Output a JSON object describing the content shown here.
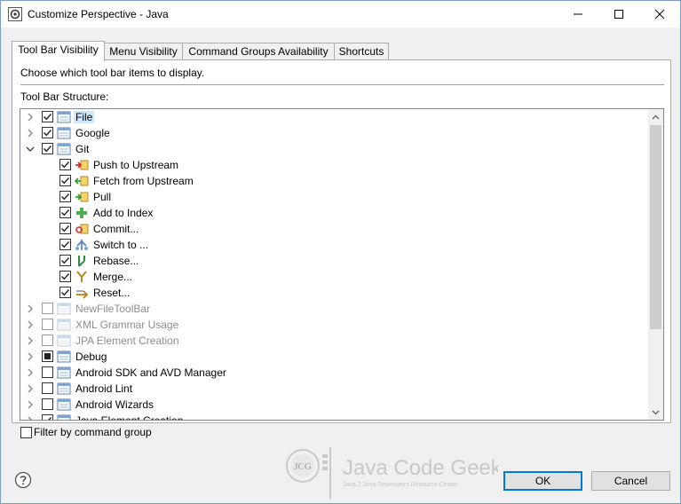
{
  "window": {
    "title": "Customize Perspective - Java"
  },
  "tabs": [
    {
      "label": "Tool Bar Visibility",
      "active": true
    },
    {
      "label": "Menu Visibility",
      "active": false
    },
    {
      "label": "Command Groups Availability",
      "active": false
    },
    {
      "label": "Shortcuts",
      "active": false
    }
  ],
  "panel": {
    "description": "Choose which tool bar items to display.",
    "structure_label": "Tool Bar Structure:"
  },
  "tree": [
    {
      "label": "File",
      "expander": "collapsed",
      "check": "checked",
      "selected": true,
      "icon": "toolbar-icon"
    },
    {
      "label": "Google",
      "expander": "collapsed",
      "check": "checked",
      "icon": "toolbar-icon"
    },
    {
      "label": "Git",
      "expander": "expanded",
      "check": "checked",
      "icon": "toolbar-icon"
    },
    {
      "label": "Push to Upstream",
      "child": true,
      "check": "checked",
      "icon": "push-icon"
    },
    {
      "label": "Fetch from Upstream",
      "child": true,
      "check": "checked",
      "icon": "fetch-icon"
    },
    {
      "label": "Pull",
      "child": true,
      "check": "checked",
      "icon": "pull-icon"
    },
    {
      "label": "Add to Index",
      "child": true,
      "check": "checked",
      "icon": "add-icon"
    },
    {
      "label": "Commit...",
      "child": true,
      "check": "checked",
      "icon": "commit-icon"
    },
    {
      "label": "Switch to ...",
      "child": true,
      "check": "checked",
      "icon": "switch-icon"
    },
    {
      "label": "Rebase...",
      "child": true,
      "check": "checked",
      "icon": "rebase-icon"
    },
    {
      "label": "Merge...",
      "child": true,
      "check": "checked",
      "icon": "merge-icon"
    },
    {
      "label": "Reset...",
      "child": true,
      "check": "checked",
      "icon": "reset-icon"
    },
    {
      "label": "NewFileToolBar",
      "expander": "collapsed",
      "check": "unchecked",
      "disabled": true,
      "icon": "toolbar-icon"
    },
    {
      "label": "XML Grammar Usage",
      "expander": "collapsed",
      "check": "unchecked",
      "disabled": true,
      "icon": "toolbar-icon"
    },
    {
      "label": "JPA Element Creation",
      "expander": "collapsed",
      "check": "unchecked",
      "disabled": true,
      "icon": "toolbar-icon"
    },
    {
      "label": "Debug",
      "expander": "collapsed",
      "check": "partial",
      "icon": "toolbar-icon"
    },
    {
      "label": "Android SDK and AVD Manager",
      "expander": "collapsed",
      "check": "unchecked",
      "icon": "toolbar-icon"
    },
    {
      "label": "Android Lint",
      "expander": "collapsed",
      "check": "unchecked",
      "icon": "toolbar-icon"
    },
    {
      "label": "Android Wizards",
      "expander": "collapsed",
      "check": "unchecked",
      "icon": "toolbar-icon"
    },
    {
      "label": "Java Element Creation",
      "expander": "collapsed",
      "check": "checked",
      "icon": "toolbar-icon"
    }
  ],
  "filter": {
    "label": "Filter by command group",
    "checked": false
  },
  "logo": {
    "name": "Java Code Geeks",
    "tagline": "Java 2 Java Developers Resource Center",
    "monogram": "JCG"
  },
  "buttons": {
    "ok": "OK",
    "cancel": "Cancel"
  },
  "colors": {
    "accent": "#0078d7",
    "selection": "#cce8ff"
  }
}
